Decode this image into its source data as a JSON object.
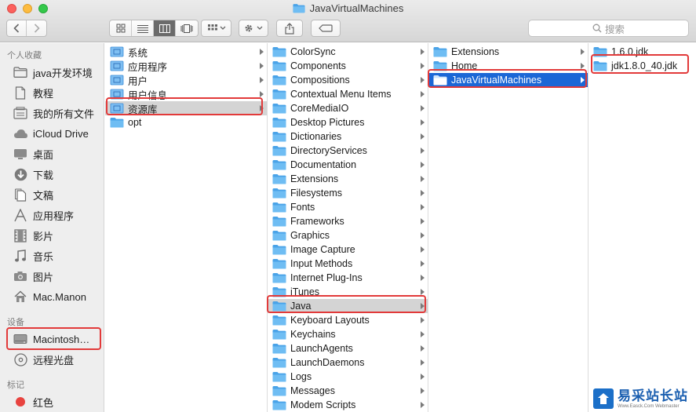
{
  "window": {
    "title": "JavaVirtualMachines"
  },
  "toolbar": {
    "search_placeholder": "搜索",
    "back": "back",
    "forward": "forward"
  },
  "sidebar": {
    "favorites_header": "个人收藏",
    "favorites": [
      {
        "label": "java开发环境",
        "icon": "folder-icon"
      },
      {
        "label": "教程",
        "icon": "document-icon"
      },
      {
        "label": "我的所有文件",
        "icon": "all-files-icon"
      },
      {
        "label": "iCloud Drive",
        "icon": "cloud-icon"
      },
      {
        "label": "桌面",
        "icon": "desktop-icon"
      },
      {
        "label": "下载",
        "icon": "download-icon"
      },
      {
        "label": "文稿",
        "icon": "documents-icon"
      },
      {
        "label": "应用程序",
        "icon": "applications-icon"
      },
      {
        "label": "影片",
        "icon": "film-icon"
      },
      {
        "label": "音乐",
        "icon": "music-icon"
      },
      {
        "label": "图片",
        "icon": "camera-icon"
      },
      {
        "label": "Mac.Manon",
        "icon": "home-icon"
      }
    ],
    "devices_header": "设备",
    "devices": [
      {
        "label": "Macintosh…",
        "icon": "harddisk-icon"
      },
      {
        "label": "远程光盘",
        "icon": "disc-icon"
      }
    ],
    "tags_header": "标记",
    "tags": [
      {
        "label": "红色",
        "color": "#e8433f"
      }
    ]
  },
  "columns": {
    "col1": [
      "系统",
      "应用程序",
      "用户",
      "用户信息",
      "资源库",
      "opt"
    ],
    "col2": [
      "ColorSync",
      "Components",
      "Compositions",
      "Contextual Menu Items",
      "CoreMediaIO",
      "Desktop Pictures",
      "Dictionaries",
      "DirectoryServices",
      "Documentation",
      "Extensions",
      "Filesystems",
      "Fonts",
      "Frameworks",
      "Graphics",
      "Image Capture",
      "Input Methods",
      "Internet Plug-Ins",
      "iTunes",
      "Java",
      "Keyboard Layouts",
      "Keychains",
      "LaunchAgents",
      "LaunchDaemons",
      "Logs",
      "Messages",
      "Modem Scripts"
    ],
    "col3": [
      "Extensions",
      "Home",
      "JavaVirtualMachines"
    ],
    "col4": [
      "1.6.0.jdk",
      "jdk1.8.0_40.jdk"
    ]
  },
  "watermark": {
    "cn": "易采站长站",
    "en": "Www.Easck.Com  Webmaster"
  },
  "colors": {
    "selection_blue": "#1b67d6",
    "selection_gray": "#d4d4d4",
    "highlight_red": "#e23a3a",
    "folder_blue": "#5fb2f0"
  }
}
